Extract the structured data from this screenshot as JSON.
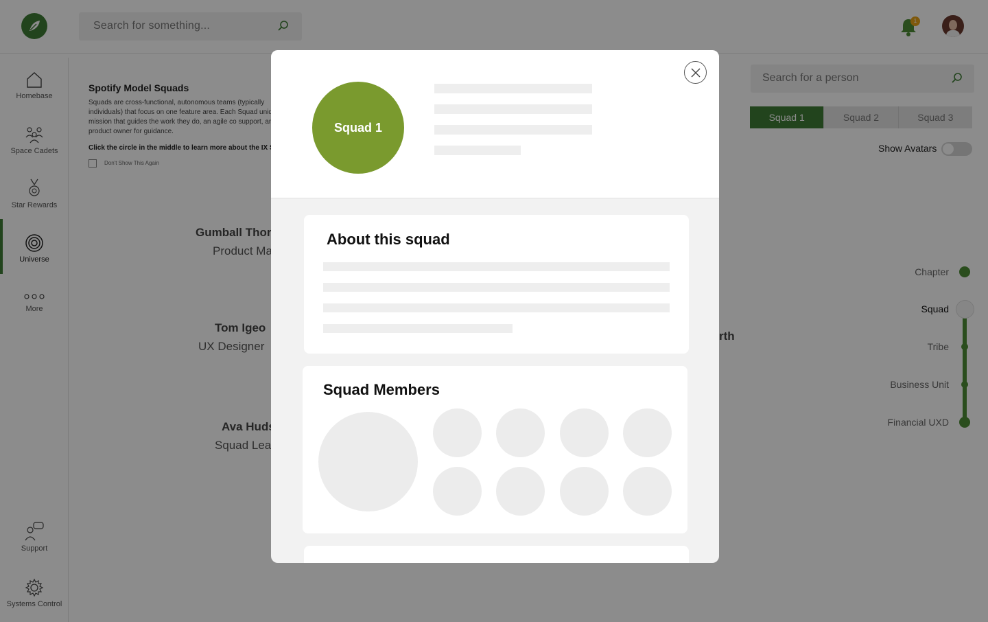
{
  "topbar": {
    "search_placeholder": "Search for something...",
    "notification_count": "1"
  },
  "sidebar": {
    "items": [
      {
        "label": "Homebase",
        "icon": "home-icon"
      },
      {
        "label": "Space Cadets",
        "icon": "people-icon"
      },
      {
        "label": "Star Rewards",
        "icon": "medal-icon"
      },
      {
        "label": "Universe",
        "icon": "target-icon",
        "active": true
      },
      {
        "label": "More",
        "icon": "more-icon"
      },
      {
        "label": "Support",
        "icon": "support-icon"
      },
      {
        "label": "Systems Control",
        "icon": "gear-icon"
      }
    ]
  },
  "info_card": {
    "title": "Spotify Model Squads",
    "description": "Squads are cross-functional, autonomous teams (typically individuals) that focus on one feature area. Each Squad unique mission that guides the work they do, an agile co support, and a product owner for guidance.",
    "cta": "Click the circle in the middle to learn more about the IX S",
    "checkbox_label": "Don't Show This Again"
  },
  "people": [
    {
      "name": "Gumball Thor",
      "role": "Product Ma"
    },
    {
      "name": "Tom Igeo",
      "role": "UX Designer"
    },
    {
      "name": "Ava Huds",
      "role": "Squad Lea"
    },
    {
      "name": "rth",
      "role": ""
    }
  ],
  "right_panel": {
    "search_placeholder": "Search for a person",
    "squad_tabs": [
      "Squad 1",
      "Squad 2",
      "Squad 3"
    ],
    "active_tab": "Squad 1",
    "show_avatars_label": "Show Avatars",
    "show_avatars_on": false,
    "levels": [
      "Chapter",
      "Squad",
      "Tribe",
      "Business Unit",
      "Financial UXD"
    ],
    "current_level": "Squad"
  },
  "modal": {
    "squad_name": "Squad 1",
    "about_title": "About this squad",
    "members_title": "Squad Members"
  },
  "colors": {
    "brand_green": "#3f7d35",
    "squad_circle": "#7a9a2e",
    "badge": "#e8a317"
  }
}
